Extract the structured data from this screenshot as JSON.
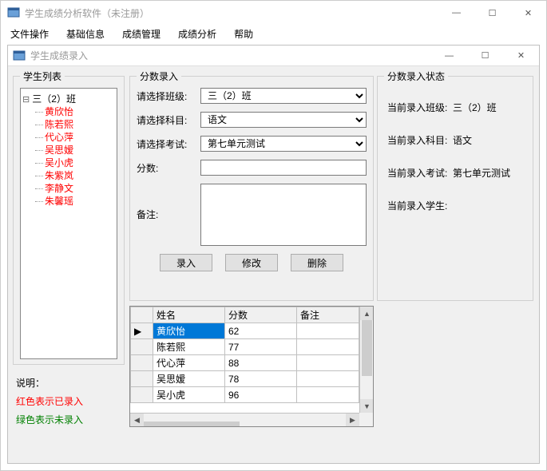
{
  "window": {
    "title": "学生成绩分析软件（未注册）",
    "child_title": "学生成绩录入"
  },
  "menu": [
    "文件操作",
    "基础信息",
    "成绩管理",
    "成绩分析",
    "帮助"
  ],
  "student_group": {
    "legend": "学生列表",
    "root": "三（2）班",
    "students": [
      "黄欣怡",
      "陈若熙",
      "代心萍",
      "吴思嫒",
      "吴小虎",
      "朱紫岚",
      "李静文",
      "朱馨瑶"
    ]
  },
  "desc": {
    "legend": "说明：",
    "red": "红色表示已录入",
    "green": "绿色表示未录入"
  },
  "entry": {
    "legend": "分数录入",
    "class_label": "请选择班级:",
    "class_value": "三（2）班",
    "subject_label": "请选择科目:",
    "subject_value": "语文",
    "exam_label": "请选择考试:",
    "exam_value": "第七单元测试",
    "score_label": "分数:",
    "score_value": "",
    "remark_label": "备注:",
    "remark_value": "",
    "btn_add": "录入",
    "btn_edit": "修改",
    "btn_del": "删除"
  },
  "status": {
    "legend": "分数录入状态",
    "class_label": "当前录入班级:",
    "class_value": "三（2）班",
    "subject_label": "当前录入科目:",
    "subject_value": "语文",
    "exam_label": "当前录入考试:",
    "exam_value": "第七单元测试",
    "student_label": "当前录入学生:",
    "student_value": ""
  },
  "grid": {
    "headers": [
      "姓名",
      "分数",
      "备注"
    ],
    "rows": [
      {
        "name": "黄欣怡",
        "score": "62",
        "remark": "",
        "selected": true,
        "pointer": true
      },
      {
        "name": "陈若熙",
        "score": "77",
        "remark": ""
      },
      {
        "name": "代心萍",
        "score": "88",
        "remark": ""
      },
      {
        "name": "吴思嫒",
        "score": "78",
        "remark": ""
      },
      {
        "name": "吴小虎",
        "score": "96",
        "remark": ""
      }
    ]
  }
}
